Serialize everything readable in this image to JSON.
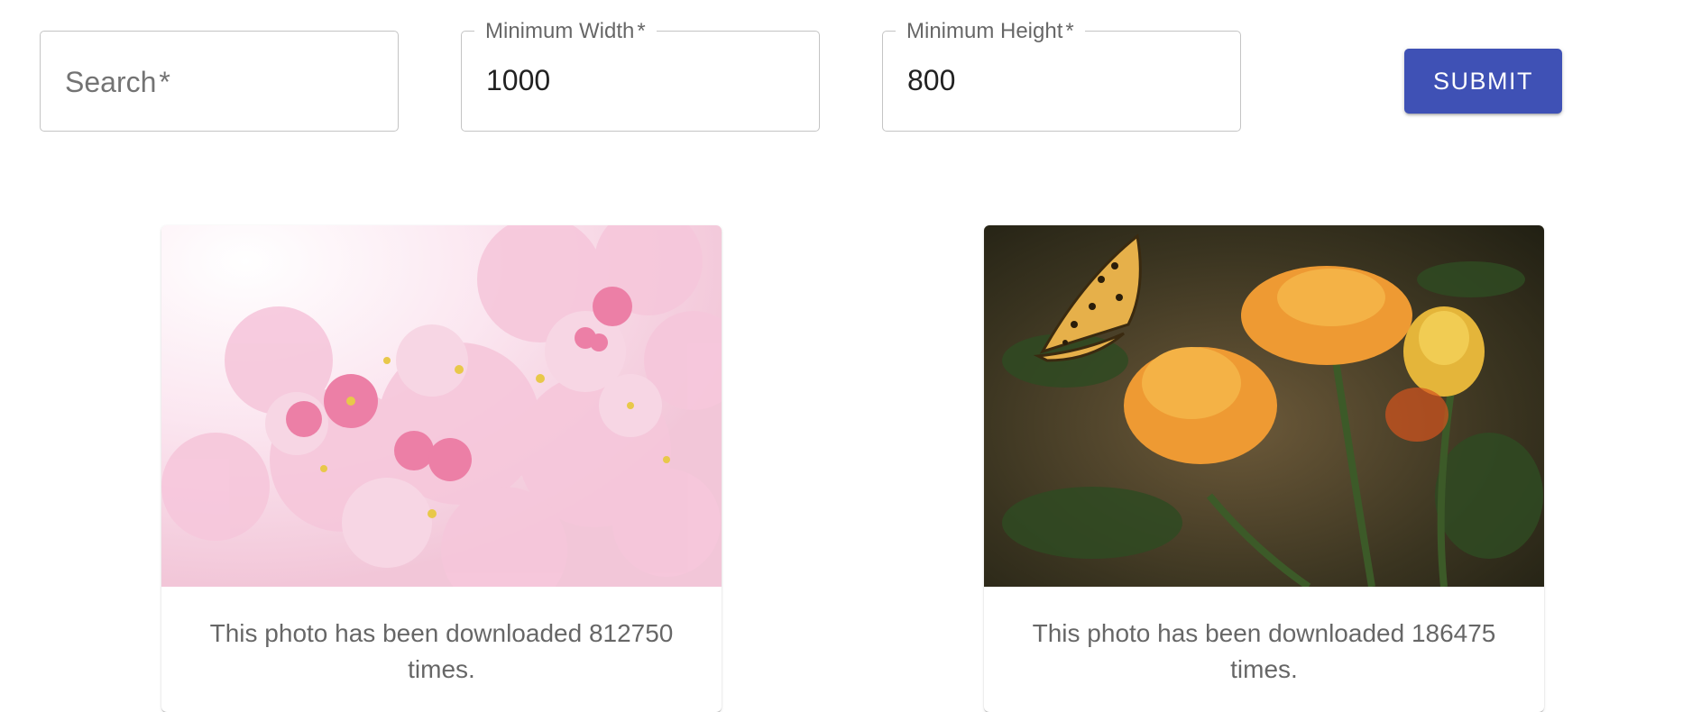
{
  "form": {
    "search": {
      "label": "Search",
      "required_mark": "*",
      "value": ""
    },
    "min_width": {
      "label": "Minimum Width",
      "required_mark": "*",
      "value": "1000"
    },
    "min_height": {
      "label": "Minimum Height",
      "required_mark": "*",
      "value": "800"
    },
    "submit_label": "SUBMIT"
  },
  "colors": {
    "primary": "#3f51b5"
  },
  "results": [
    {
      "caption": "This photo has been downloaded 812750 times.",
      "image": "pink cherry blossom flowers"
    },
    {
      "caption": "This photo has been downloaded 186475 times.",
      "image": "orange flowers with butterfly"
    }
  ]
}
